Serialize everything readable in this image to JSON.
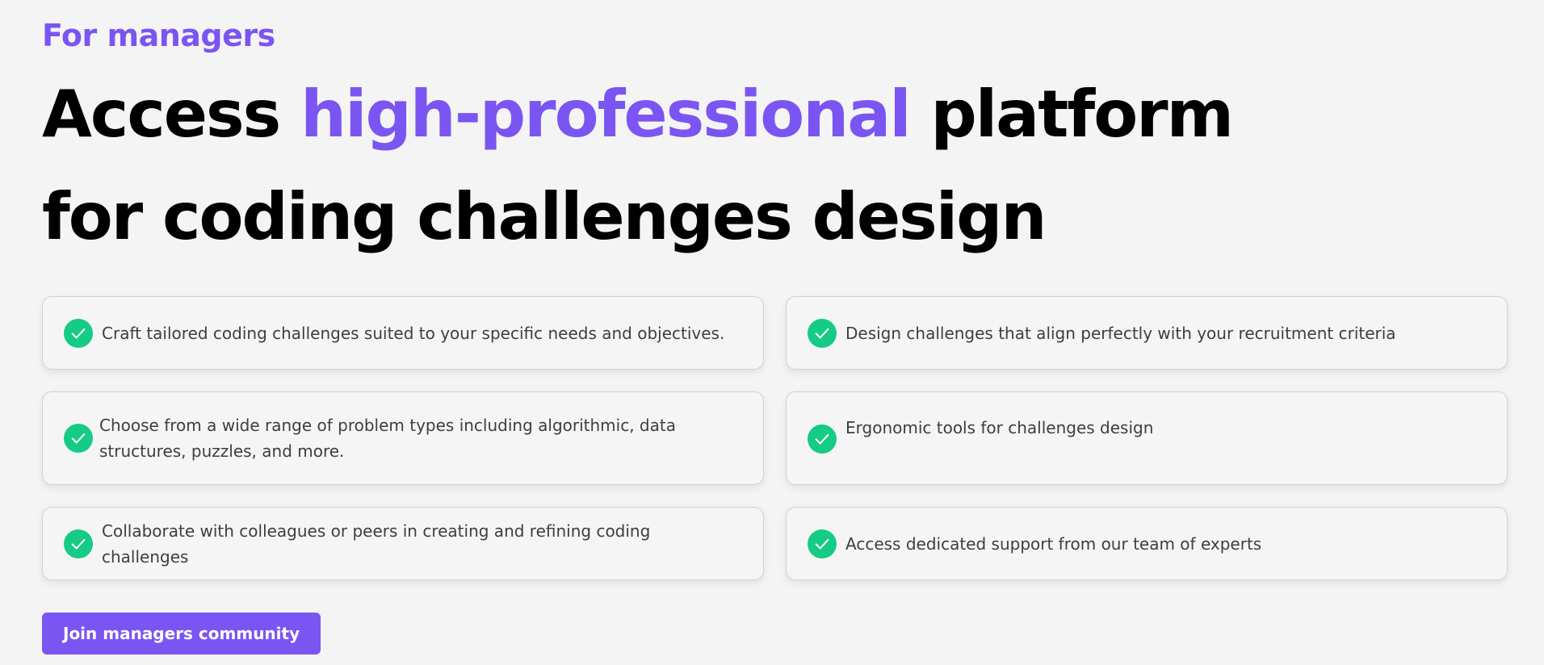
{
  "hero": {
    "eyebrow": "For managers",
    "headline_part1": "Access ",
    "headline_accent": "high-professional",
    "headline_part2": " platform",
    "headline_line2": "for coding challenges design"
  },
  "features": [
    {
      "text": "Craft tailored coding challenges suited to your specific needs and objectives."
    },
    {
      "text": "Design challenges that align perfectly with your recruitment criteria"
    },
    {
      "text": "Choose from a wide range of problem types including algorithmic, data structures, puzzles, and more."
    },
    {
      "text": "Ergonomic tools for challenges design"
    },
    {
      "text": "Collaborate with colleagues or peers in creating and refining coding challenges"
    },
    {
      "text": "Access dedicated support from our team of experts"
    }
  ],
  "cta": {
    "label": "Join managers community"
  },
  "icons": {
    "feature": "check-circle-icon"
  },
  "colors": {
    "accent": "#7b55f2",
    "check": "#15cb86",
    "background": "#f4f4f4",
    "text": "#3e3e3e"
  }
}
